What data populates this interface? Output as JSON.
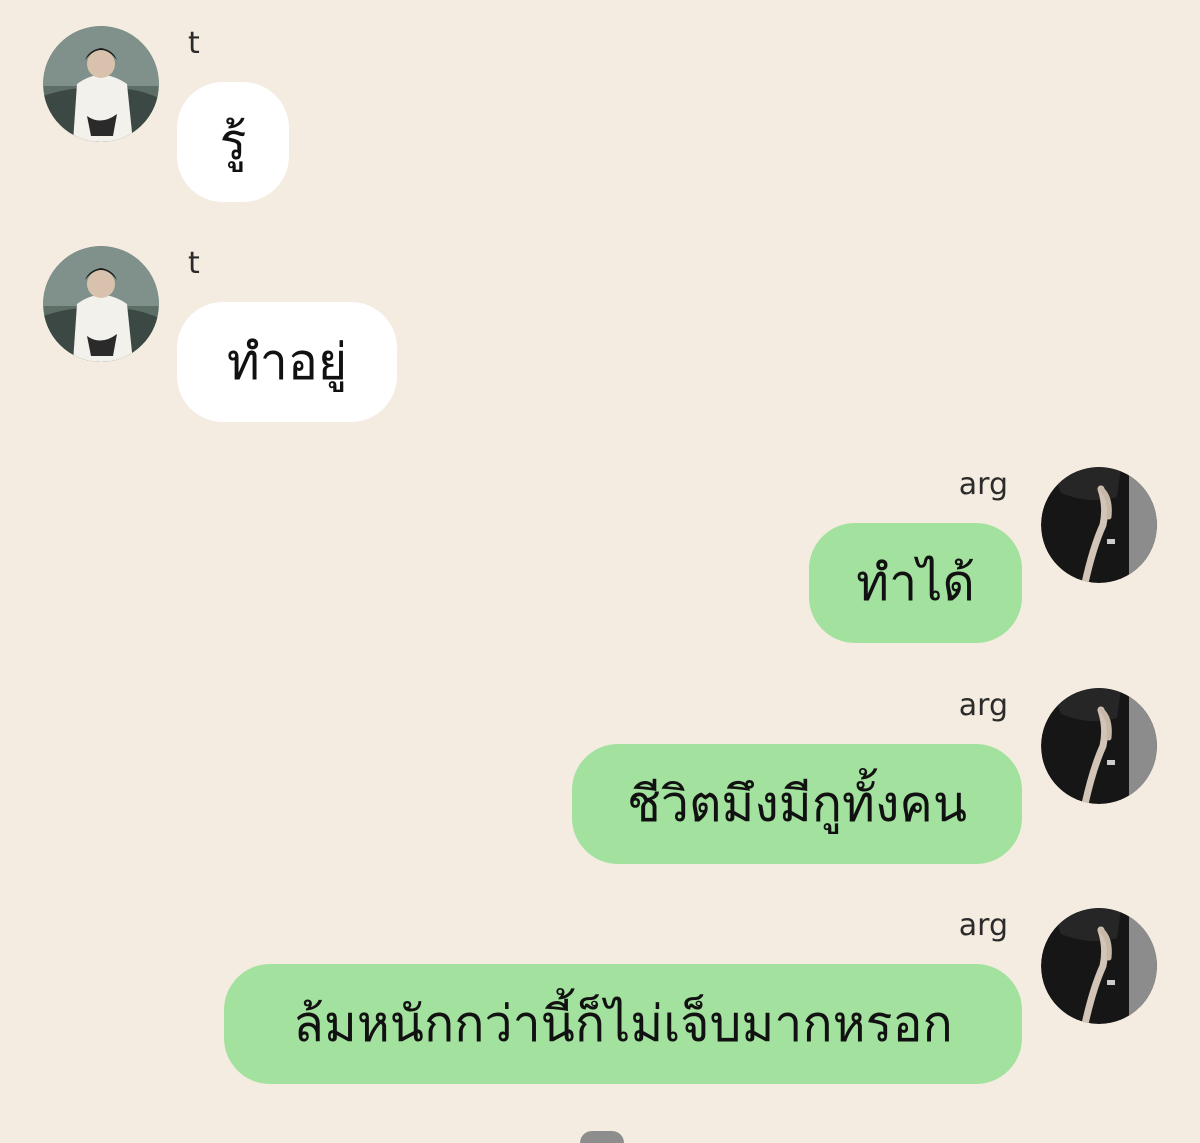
{
  "messages": [
    {
      "sender": "t",
      "text": "รู้",
      "side": "incoming"
    },
    {
      "sender": "t",
      "text": "ทำอยู่",
      "side": "incoming"
    },
    {
      "sender": "arg",
      "text": "ทำได้",
      "side": "outgoing"
    },
    {
      "sender": "arg",
      "text": "ชีวิตมึงมีกูทั้งคน",
      "side": "outgoing"
    },
    {
      "sender": "arg",
      "text": "ล้มหนักกว่านี้ก็ไม่เจ็บมากหรอก",
      "side": "outgoing"
    }
  ],
  "colors": {
    "background": "#f4ece0",
    "incoming_bubble": "#ffffff",
    "outgoing_bubble": "#a3e19e"
  }
}
